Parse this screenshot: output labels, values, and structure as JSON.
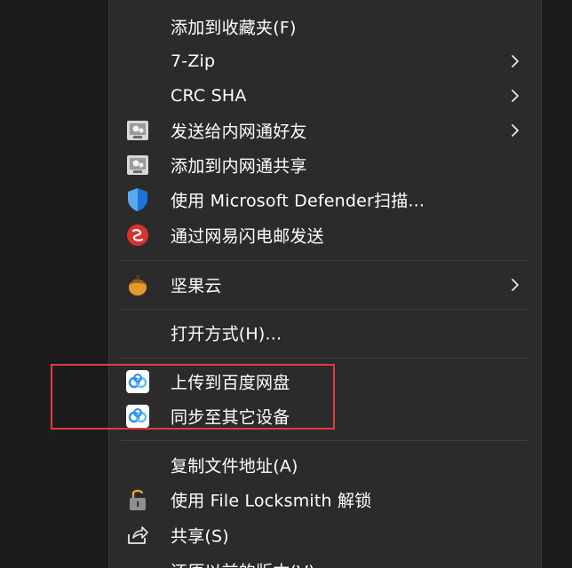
{
  "menu": {
    "items": [
      {
        "key": "top_partial",
        "label": "",
        "icon": "partial-app-icon",
        "submenu": false
      },
      {
        "key": "favorites",
        "label": "添加到收藏夹(F)",
        "icon": "",
        "submenu": false
      },
      {
        "key": "seven_zip",
        "label": "7-Zip",
        "icon": "",
        "submenu": true
      },
      {
        "key": "crc_sha",
        "label": "CRC SHA",
        "icon": "",
        "submenu": true
      },
      {
        "key": "send_lan_friend",
        "label": "发送给内网通好友",
        "icon": "lan-share-icon",
        "submenu": true
      },
      {
        "key": "add_lan_share",
        "label": "添加到内网通共享",
        "icon": "lan-share-icon",
        "submenu": false
      },
      {
        "key": "defender_scan",
        "label": "使用 Microsoft Defender扫描...",
        "icon": "shield-icon",
        "submenu": false
      },
      {
        "key": "netease_send",
        "label": "通过网易闪电邮发送",
        "icon": "netease-mail-icon",
        "submenu": false
      },
      {
        "key": "jianguoyun",
        "label": "坚果云",
        "icon": "nut-icon",
        "submenu": true
      },
      {
        "key": "open_with",
        "label": "打开方式(H)...",
        "icon": "",
        "submenu": false
      },
      {
        "key": "upload_baidu",
        "label": "上传到百度网盘",
        "icon": "baidu-netdisk-icon",
        "submenu": false
      },
      {
        "key": "sync_devices",
        "label": "同步至其它设备",
        "icon": "baidu-netdisk-icon",
        "submenu": false
      },
      {
        "key": "copy_path",
        "label": "复制文件地址(A)",
        "icon": "",
        "submenu": false
      },
      {
        "key": "file_locksmith",
        "label": "使用 File Locksmith 解锁",
        "icon": "unlock-icon",
        "submenu": false
      },
      {
        "key": "share",
        "label": "共享(S)",
        "icon": "share-icon",
        "submenu": false
      },
      {
        "key": "restore_prev",
        "label": "还原以前的版本(V)",
        "icon": "",
        "submenu": false
      }
    ]
  },
  "colors": {
    "menu_bg": "#2b2b2b",
    "outer_bg": "#1c1c1c",
    "text": "#ffffff",
    "separator": "#3d3d3d",
    "highlight_border": "#e03c3c",
    "defender_blue": "#1e73d8",
    "netease_red": "#d9322e",
    "nut_orange": "#e49a2a",
    "baidu_blue": "#2e8bf0"
  }
}
